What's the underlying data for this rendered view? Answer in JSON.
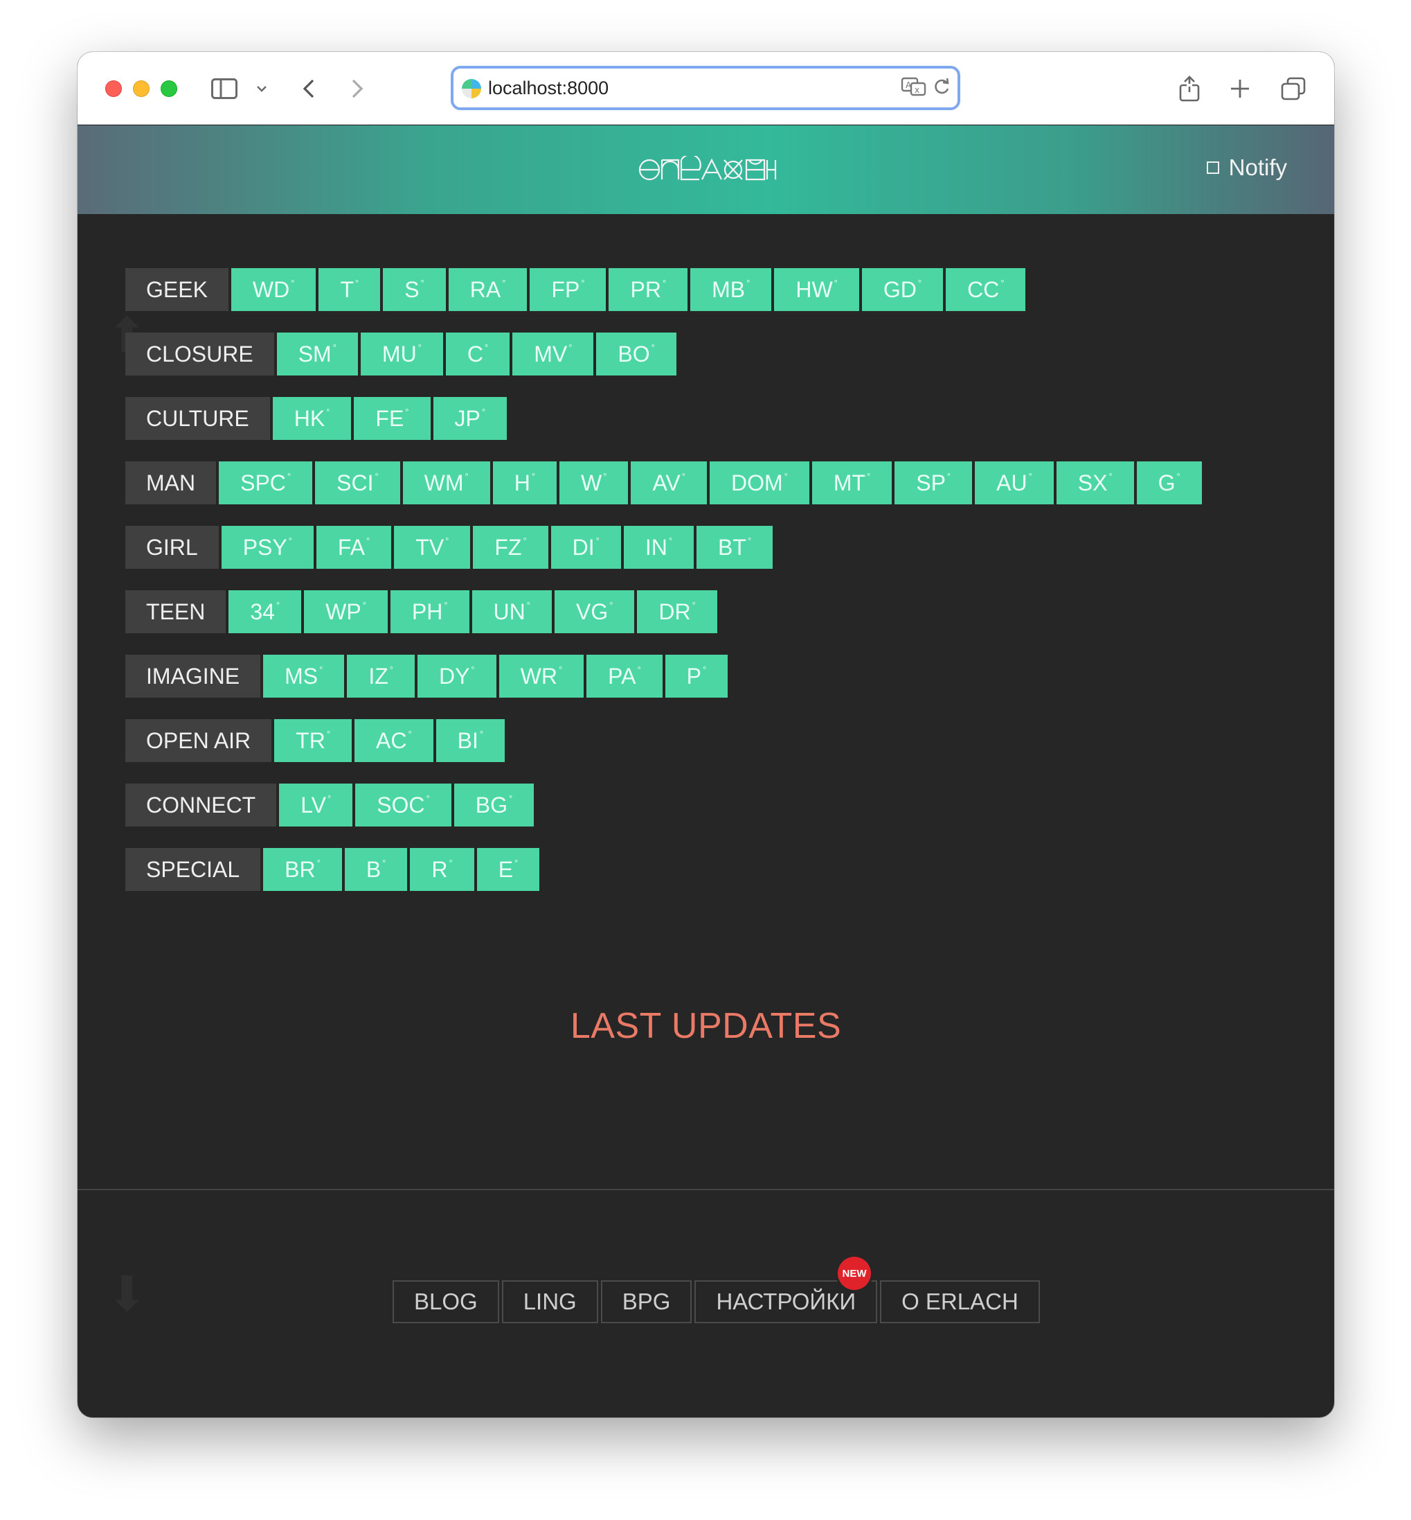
{
  "browser": {
    "url": "localhost:8000"
  },
  "header": {
    "logo_alt": "ЕРЛАХ",
    "notify_label": "Notify"
  },
  "categories": [
    {
      "label": "GEEK",
      "tags": [
        "WD",
        "T",
        "S",
        "RA",
        "FP",
        "PR",
        "MB",
        "HW",
        "GD",
        "CC"
      ]
    },
    {
      "label": "CLOSURE",
      "tags": [
        "SM",
        "MU",
        "C",
        "MV",
        "BO"
      ]
    },
    {
      "label": "CULTURE",
      "tags": [
        "HK",
        "FE",
        "JP"
      ]
    },
    {
      "label": "MAN",
      "tags": [
        "SPC",
        "SCI",
        "WM",
        "H",
        "W",
        "AV",
        "DOM",
        "MT",
        "SP",
        "AU",
        "SX",
        "G"
      ]
    },
    {
      "label": "GIRL",
      "tags": [
        "PSY",
        "FA",
        "TV",
        "FZ",
        "DI",
        "IN",
        "BT"
      ]
    },
    {
      "label": "TEEN",
      "tags": [
        "34",
        "WP",
        "PH",
        "UN",
        "VG",
        "DR"
      ]
    },
    {
      "label": "IMAGINE",
      "tags": [
        "MS",
        "IZ",
        "DY",
        "WR",
        "PA",
        "P"
      ]
    },
    {
      "label": "OPEN AIR",
      "tags": [
        "TR",
        "AC",
        "BI"
      ]
    },
    {
      "label": "CONNECT",
      "tags": [
        "LV",
        "SOC",
        "BG"
      ]
    },
    {
      "label": "SPECIAL",
      "tags": [
        "BR",
        "B",
        "R",
        "E"
      ]
    }
  ],
  "tag_marker": "°",
  "last_updates_title": "LAST UPDATES",
  "footer": {
    "links": [
      "BLOG",
      "LING",
      "BPG",
      "НАСТРОЙКИ",
      "О ERLACH"
    ],
    "new_badge": "NEW"
  },
  "colors": {
    "tag_bg": "#4cd6a3",
    "category_bg": "#404040",
    "page_bg": "#262626",
    "accent_title": "#ea7a65",
    "badge": "#e0232b"
  }
}
